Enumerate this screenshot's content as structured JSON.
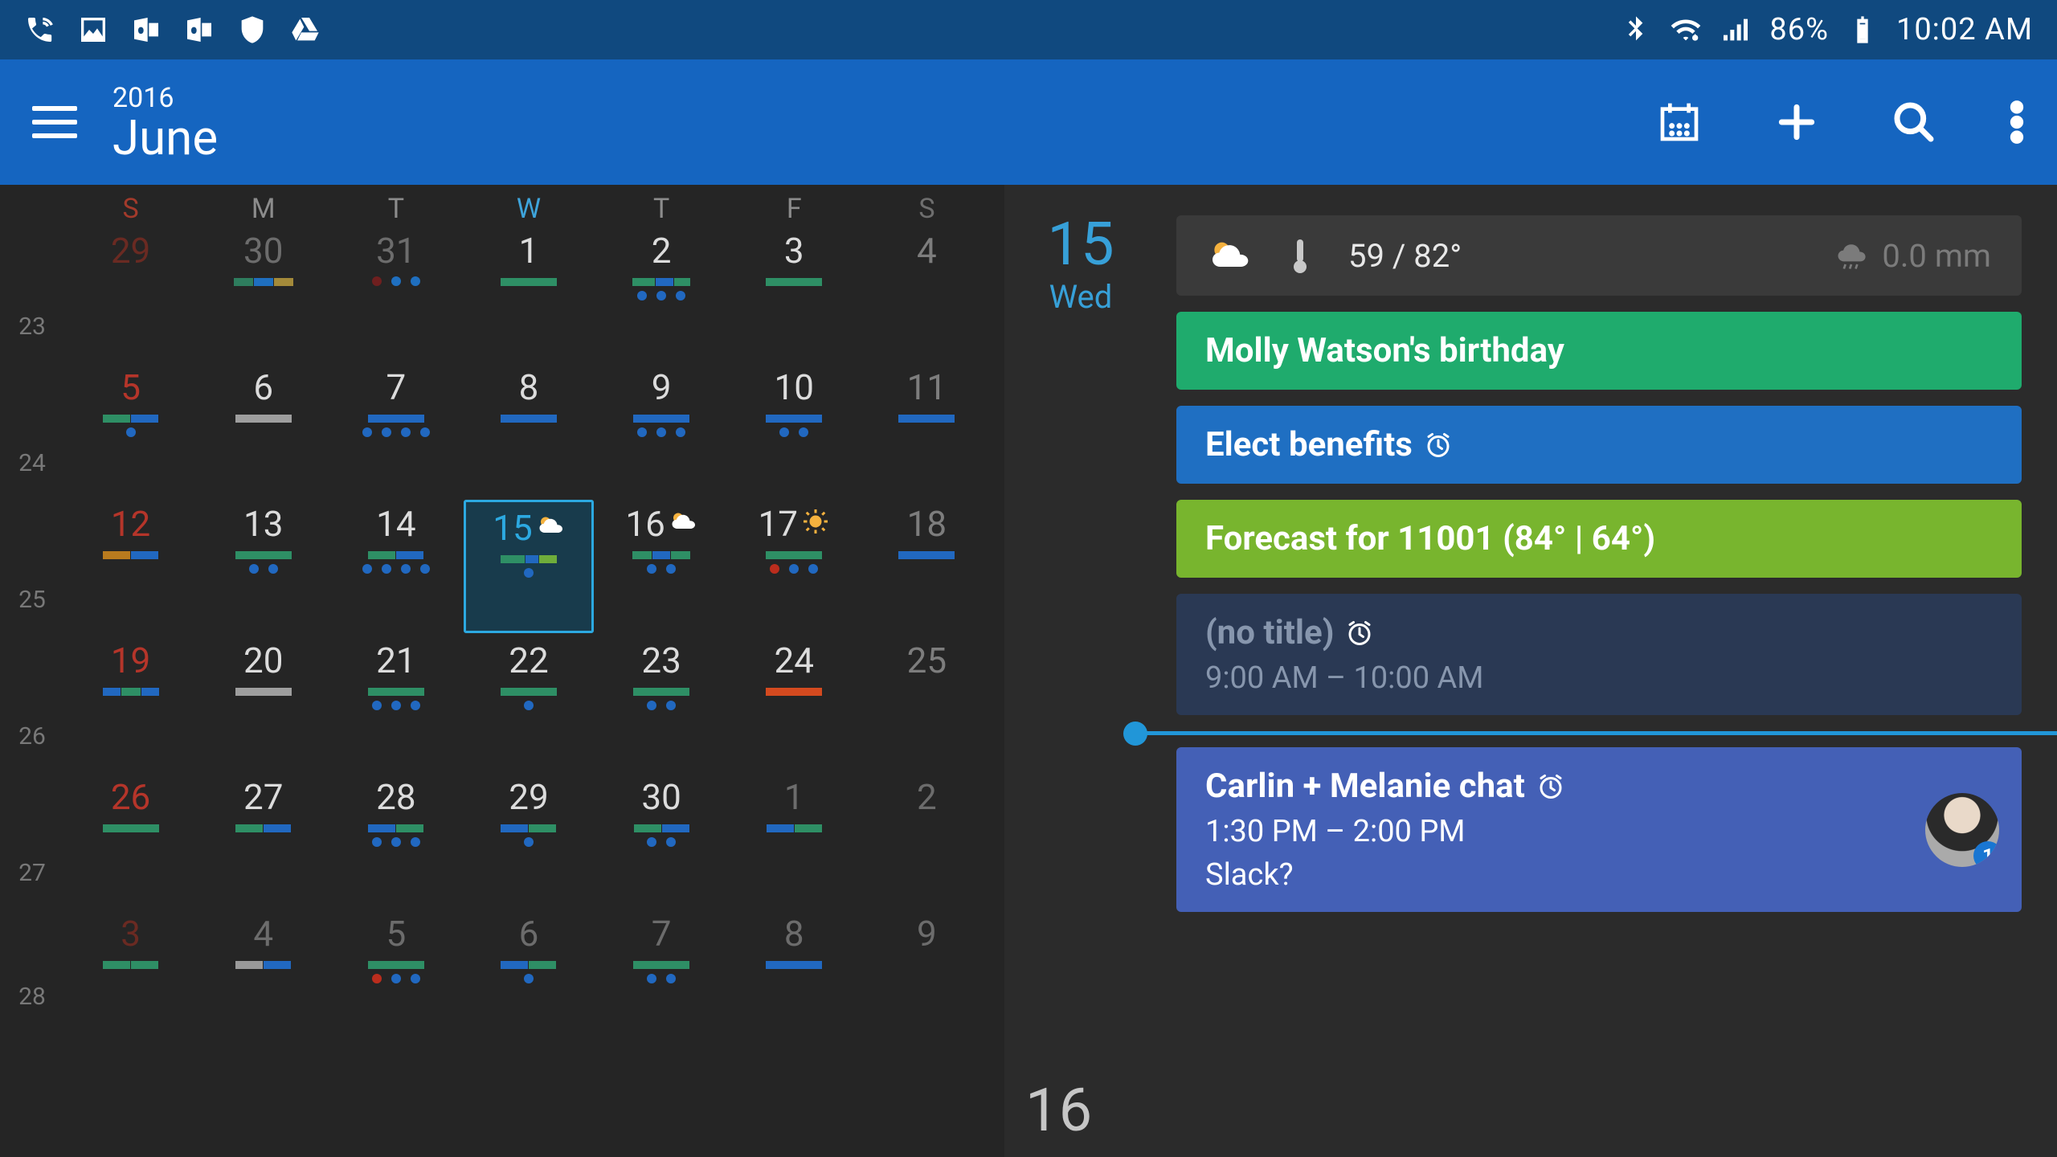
{
  "status": {
    "battery": "86%",
    "time": "10:02 AM"
  },
  "header": {
    "year": "2016",
    "month": "June"
  },
  "calendar": {
    "day_labels": [
      "S",
      "M",
      "T",
      "W",
      "T",
      "F",
      "S"
    ],
    "weeks": [
      {
        "num": "23",
        "days": [
          {
            "n": "29",
            "cls": "outside sun",
            "stripes": [],
            "dots": []
          },
          {
            "n": "30",
            "cls": "outside",
            "stripes": [
              [
                "#2e7d5e",
                24
              ],
              [
                "#1f6fbf",
                24
              ],
              [
                "#a48a3a",
                24
              ]
            ],
            "dots": []
          },
          {
            "n": "31",
            "cls": "outside",
            "stripes": [],
            "dots": [
              [
                "#6f1f1f"
              ],
              [
                "#1f6fbf"
              ],
              [
                "#1f6fbf"
              ]
            ]
          },
          {
            "n": "1",
            "cls": "",
            "stripes": [
              [
                "#2e8f65",
                70
              ]
            ],
            "dots": []
          },
          {
            "n": "2",
            "cls": "",
            "stripes": [
              [
                "#2e8f65",
                28
              ],
              [
                "#2168c0",
                22
              ],
              [
                "#2e8f65",
                20
              ]
            ],
            "dots": [
              [
                "#2168c0"
              ],
              [
                "#2168c0"
              ],
              [
                "#2168c0"
              ]
            ]
          },
          {
            "n": "3",
            "cls": "",
            "stripes": [
              [
                "#2e8f65",
                70
              ]
            ],
            "dots": []
          },
          {
            "n": "4",
            "cls": "sat",
            "stripes": [],
            "dots": []
          }
        ]
      },
      {
        "num": "24",
        "days": [
          {
            "n": "5",
            "cls": "sun",
            "stripes": [
              [
                "#2e8f65",
                34
              ],
              [
                "#2168c0",
                34
              ]
            ],
            "dots": [
              [
                "#2168c0"
              ]
            ]
          },
          {
            "n": "6",
            "cls": "",
            "stripes": [
              [
                "#9e9e9e",
                70
              ]
            ],
            "dots": []
          },
          {
            "n": "7",
            "cls": "",
            "stripes": [
              [
                "#2168c0",
                70
              ]
            ],
            "dots": [
              [
                "#2168c0"
              ],
              [
                "#2168c0"
              ],
              [
                "#2168c0"
              ],
              [
                "#2168c0"
              ]
            ]
          },
          {
            "n": "8",
            "cls": "",
            "stripes": [
              [
                "#2168c0",
                70
              ]
            ],
            "dots": []
          },
          {
            "n": "9",
            "cls": "",
            "stripes": [
              [
                "#2168c0",
                70
              ]
            ],
            "dots": [
              [
                "#2168c0"
              ],
              [
                "#2168c0"
              ],
              [
                "#2168c0"
              ]
            ]
          },
          {
            "n": "10",
            "cls": "",
            "stripes": [
              [
                "#2168c0",
                70
              ]
            ],
            "dots": [
              [
                "#2168c0"
              ],
              [
                "#2168c0"
              ]
            ]
          },
          {
            "n": "11",
            "cls": "sat",
            "stripes": [
              [
                "#2168c0",
                70
              ]
            ],
            "dots": []
          }
        ]
      },
      {
        "num": "25",
        "days": [
          {
            "n": "12",
            "cls": "sun",
            "stripes": [
              [
                "#b97b1e",
                34
              ],
              [
                "#2168c0",
                34
              ]
            ],
            "dots": []
          },
          {
            "n": "13",
            "cls": "",
            "stripes": [
              [
                "#2e8f65",
                70
              ]
            ],
            "dots": [
              [
                "#2168c0"
              ],
              [
                "#2168c0"
              ]
            ]
          },
          {
            "n": "14",
            "cls": "",
            "stripes": [
              [
                "#2e8f65",
                34
              ],
              [
                "#2168c0",
                34
              ]
            ],
            "dots": [
              [
                "#2168c0"
              ],
              [
                "#2168c0"
              ],
              [
                "#2168c0"
              ],
              [
                "#2168c0"
              ]
            ]
          },
          {
            "n": "15",
            "cls": "selected",
            "stripes": [
              [
                "#2e8f65",
                30
              ],
              [
                "#2168c0",
                16
              ],
              [
                "#6fad3b",
                22
              ]
            ],
            "dots": [
              [
                "#2168c0"
              ]
            ],
            "weather": "cloud"
          },
          {
            "n": "16",
            "cls": "",
            "stripes": [
              [
                "#2e8f65",
                24
              ],
              [
                "#2168c0",
                22
              ],
              [
                "#2e8f65",
                24
              ]
            ],
            "dots": [
              [
                "#2168c0"
              ],
              [
                "#2168c0"
              ]
            ],
            "weather": "cloud"
          },
          {
            "n": "17",
            "cls": "",
            "stripes": [
              [
                "#2e8f65",
                70
              ]
            ],
            "dots": [
              [
                "#bb2d1d"
              ],
              [
                "#2168c0"
              ],
              [
                "#2168c0"
              ]
            ],
            "weather": "sun"
          },
          {
            "n": "18",
            "cls": "sat",
            "stripes": [
              [
                "#2168c0",
                70
              ]
            ],
            "dots": []
          }
        ]
      },
      {
        "num": "26",
        "days": [
          {
            "n": "19",
            "cls": "sun",
            "stripes": [
              [
                "#2168c0",
                22
              ],
              [
                "#2e8f65",
                24
              ],
              [
                "#2168c0",
                22
              ]
            ],
            "dots": []
          },
          {
            "n": "20",
            "cls": "",
            "stripes": [
              [
                "#9e9e9e",
                70
              ]
            ],
            "dots": []
          },
          {
            "n": "21",
            "cls": "",
            "stripes": [
              [
                "#2e8f65",
                70
              ]
            ],
            "dots": [
              [
                "#2168c0"
              ],
              [
                "#2168c0"
              ],
              [
                "#2168c0"
              ]
            ]
          },
          {
            "n": "22",
            "cls": "",
            "stripes": [
              [
                "#2e8f65",
                70
              ]
            ],
            "dots": [
              [
                "#2168c0"
              ]
            ]
          },
          {
            "n": "23",
            "cls": "",
            "stripes": [
              [
                "#2e8f65",
                70
              ]
            ],
            "dots": [
              [
                "#2168c0"
              ],
              [
                "#2168c0"
              ]
            ]
          },
          {
            "n": "24",
            "cls": "",
            "stripes": [
              [
                "#d44a1f",
                70
              ]
            ],
            "dots": []
          },
          {
            "n": "25",
            "cls": "sat",
            "stripes": [],
            "dots": []
          }
        ]
      },
      {
        "num": "27",
        "days": [
          {
            "n": "26",
            "cls": "sun",
            "stripes": [
              [
                "#2e8f65",
                70
              ]
            ],
            "dots": []
          },
          {
            "n": "27",
            "cls": "",
            "stripes": [
              [
                "#2e8f65",
                34
              ],
              [
                "#2168c0",
                34
              ]
            ],
            "dots": []
          },
          {
            "n": "28",
            "cls": "",
            "stripes": [
              [
                "#2168c0",
                34
              ],
              [
                "#2e8f65",
                34
              ]
            ],
            "dots": [
              [
                "#2168c0"
              ],
              [
                "#2168c0"
              ],
              [
                "#2168c0"
              ]
            ]
          },
          {
            "n": "29",
            "cls": "",
            "stripes": [
              [
                "#2168c0",
                34
              ],
              [
                "#2e8f65",
                34
              ]
            ],
            "dots": [
              [
                "#2168c0"
              ]
            ]
          },
          {
            "n": "30",
            "cls": "",
            "stripes": [
              [
                "#2e8f65",
                34
              ],
              [
                "#2168c0",
                34
              ]
            ],
            "dots": [
              [
                "#2168c0"
              ],
              [
                "#2168c0"
              ]
            ]
          },
          {
            "n": "1",
            "cls": "outside",
            "stripes": [
              [
                "#2168c0",
                34
              ],
              [
                "#2e8f65",
                34
              ]
            ],
            "dots": []
          },
          {
            "n": "2",
            "cls": "outside sat",
            "stripes": [],
            "dots": []
          }
        ]
      },
      {
        "num": "28",
        "days": [
          {
            "n": "3",
            "cls": "outside sun",
            "stripes": [
              [
                "#2e8f65",
                34
              ],
              [
                "#2e8f65",
                34
              ]
            ],
            "dots": []
          },
          {
            "n": "4",
            "cls": "outside",
            "stripes": [
              [
                "#9a9a9a",
                34
              ],
              [
                "#2168c0",
                34
              ]
            ],
            "dots": []
          },
          {
            "n": "5",
            "cls": "outside",
            "stripes": [
              [
                "#2e8f65",
                70
              ]
            ],
            "dots": [
              [
                "#bb2d1d"
              ],
              [
                "#2168c0"
              ],
              [
                "#2168c0"
              ]
            ]
          },
          {
            "n": "6",
            "cls": "outside",
            "stripes": [
              [
                "#2168c0",
                34
              ],
              [
                "#2e8f65",
                34
              ]
            ],
            "dots": [
              [
                "#2168c0"
              ]
            ]
          },
          {
            "n": "7",
            "cls": "outside",
            "stripes": [
              [
                "#2e8f65",
                70
              ]
            ],
            "dots": [
              [
                "#2168c0"
              ],
              [
                "#2168c0"
              ]
            ]
          },
          {
            "n": "8",
            "cls": "outside",
            "stripes": [
              [
                "#2168c0",
                70
              ]
            ],
            "dots": []
          },
          {
            "n": "9",
            "cls": "outside",
            "stripes": [],
            "dots": []
          }
        ]
      }
    ]
  },
  "agenda": {
    "selected_day": "15",
    "selected_dow": "Wed",
    "weather": {
      "temps": "59 / 82°",
      "precip": "0.0 mm"
    },
    "events": [
      {
        "title": "Molly Watson's birthday",
        "color": "#1fab6d",
        "alarm": false
      },
      {
        "title": "Elect benefits",
        "color": "#1f6fc2",
        "alarm": true
      },
      {
        "title": "Forecast for 11001 (84° | 64°)",
        "color": "#78b52e",
        "alarm": false
      },
      {
        "title": "(no title)",
        "sub": "9:00 AM – 10:00 AM",
        "color": "#2a3954",
        "alarm": true,
        "muted": true
      },
      {
        "title": "Carlin + Melanie chat",
        "sub": "1:30 PM – 2:00 PM",
        "desc": "Slack?",
        "color": "#4460b6",
        "alarm": true,
        "avatar": true,
        "avatar_badge": "1"
      }
    ],
    "next_day": "16"
  }
}
